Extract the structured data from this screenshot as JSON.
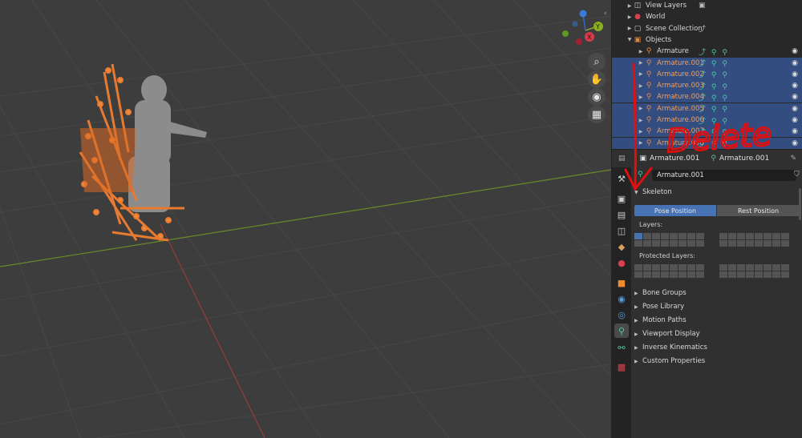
{
  "outliner": {
    "rows": [
      {
        "label": "View Layers",
        "icon": "view-layer-icon",
        "indent": 0,
        "selected": false,
        "orange": false
      },
      {
        "label": "World",
        "icon": "world-icon",
        "indent": 0,
        "selected": false,
        "orange": false
      },
      {
        "label": "Scene Collection",
        "icon": "collection-icon",
        "indent": 0,
        "selected": false,
        "orange": false
      },
      {
        "label": "Objects",
        "icon": "objects-folder-icon",
        "indent": 0,
        "selected": false,
        "orange": false
      },
      {
        "label": "Armature",
        "icon": "armature-icon",
        "indent": 1,
        "selected": false,
        "orange": false
      },
      {
        "label": "Armature.001",
        "icon": "armature-icon",
        "indent": 1,
        "selected": true,
        "orange": true
      },
      {
        "label": "Armature.002",
        "icon": "armature-icon",
        "indent": 1,
        "selected": true,
        "orange": true
      },
      {
        "label": "Armature.003",
        "icon": "armature-icon",
        "indent": 1,
        "selected": true,
        "orange": true
      },
      {
        "label": "Armature.004",
        "icon": "armature-icon",
        "indent": 1,
        "selected": true,
        "orange": true
      },
      {
        "label": "Armature.005",
        "icon": "armature-icon",
        "indent": 1,
        "selected": true,
        "orange": true
      },
      {
        "label": "Armature.006",
        "icon": "armature-icon",
        "indent": 1,
        "selected": true,
        "orange": true
      },
      {
        "label": "Armature.007",
        "icon": "armature-icon",
        "indent": 1,
        "selected": true,
        "orange": true
      },
      {
        "label": "Armature.008",
        "icon": "armature-icon",
        "indent": 1,
        "selected": true,
        "orange": true
      }
    ]
  },
  "properties": {
    "header_object": "Armature.001",
    "header_data": "Armature.001",
    "name_field": "Armature.001",
    "skeleton_label": "Skeleton",
    "pose_position_label": "Pose Position",
    "rest_position_label": "Rest Position",
    "layers_label": "Layers:",
    "protected_layers_label": "Protected Layers:",
    "panels": [
      "Bone Groups",
      "Pose Library",
      "Motion Paths",
      "Viewport Display",
      "Inverse Kinematics",
      "Custom Properties"
    ]
  },
  "annotation": {
    "text": "Delete"
  },
  "gizmo": {
    "x_label": "X",
    "y_label": "Y"
  },
  "colors": {
    "selection": "#334d80",
    "accent_orange": "#f0a060",
    "active_blue": "#4772b3",
    "annotation_red": "#e01010"
  }
}
